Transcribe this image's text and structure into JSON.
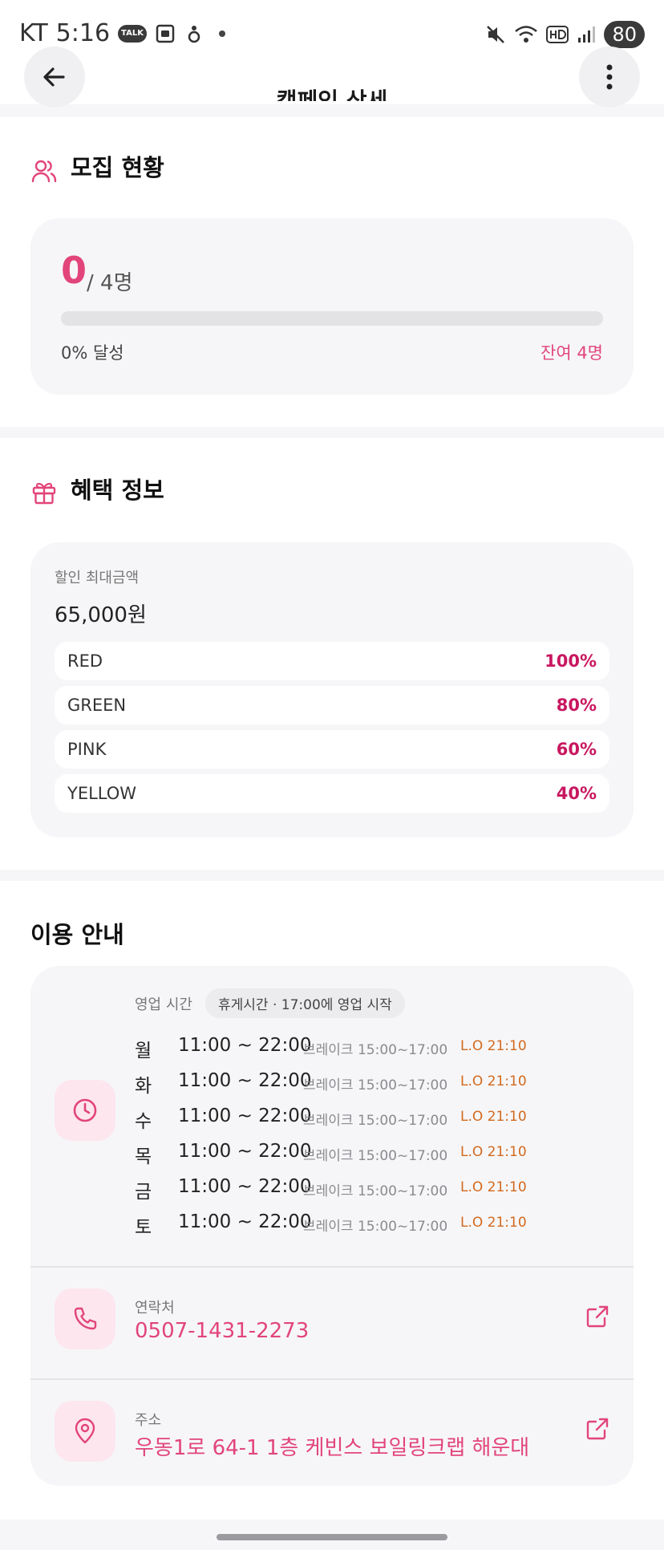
{
  "status_bar": {
    "carrier": "KT",
    "time": "5:16",
    "talk_badge": "TALK",
    "battery": "80"
  },
  "header": {
    "title": "캠페인 상세"
  },
  "recruitment": {
    "title": "모집 현황",
    "current": "0",
    "total": "/ 4명",
    "progress_percent": 0,
    "achieved": "0% 달성",
    "remaining": "잔여 4명"
  },
  "benefit": {
    "title": "혜택 정보",
    "max_label": "할인 최대금액",
    "max_amount": "65,000원",
    "tiers": [
      {
        "name": "RED",
        "percent": "100%"
      },
      {
        "name": "GREEN",
        "percent": "80%"
      },
      {
        "name": "PINK",
        "percent": "60%"
      },
      {
        "name": "YELLOW",
        "percent": "40%"
      }
    ]
  },
  "usage": {
    "title": "이용 안내",
    "hours_label": "영업 시간",
    "hours_status": "휴게시간 · 17:00에 영업 시작",
    "schedule": [
      {
        "day": "월",
        "time": "11:00 ~ 22:00",
        "break": "브레이크 15:00~17:00",
        "lo": "L.O 21:10"
      },
      {
        "day": "화",
        "time": "11:00 ~ 22:00",
        "break": "브레이크 15:00~17:00",
        "lo": "L.O 21:10"
      },
      {
        "day": "수",
        "time": "11:00 ~ 22:00",
        "break": "브레이크 15:00~17:00",
        "lo": "L.O 21:10"
      },
      {
        "day": "목",
        "time": "11:00 ~ 22:00",
        "break": "브레이크 15:00~17:00",
        "lo": "L.O 21:10"
      },
      {
        "day": "금",
        "time": "11:00 ~ 22:00",
        "break": "브레이크 15:00~17:00",
        "lo": "L.O 21:10"
      },
      {
        "day": "토",
        "time": "11:00 ~ 22:00",
        "break": "브레이크 15:00~17:00",
        "lo": "L.O 21:10"
      }
    ],
    "contact_label": "연락처",
    "contact_value": "0507-1431-2273",
    "address_label": "주소",
    "address_value": "우동1로 64-1 1층 케빈스 보일링크랩 해운대"
  },
  "colors": {
    "accent": "#e2457a",
    "tier_percent": "#c8175f",
    "last_order": "#d2691e"
  },
  "icons": {
    "back": "arrow-left-icon",
    "more": "more-vertical-icon",
    "recruit": "users-icon",
    "benefit": "gift-icon",
    "hours": "clock-icon",
    "contact": "phone-icon",
    "address": "map-pin-icon",
    "external": "external-link-icon"
  }
}
